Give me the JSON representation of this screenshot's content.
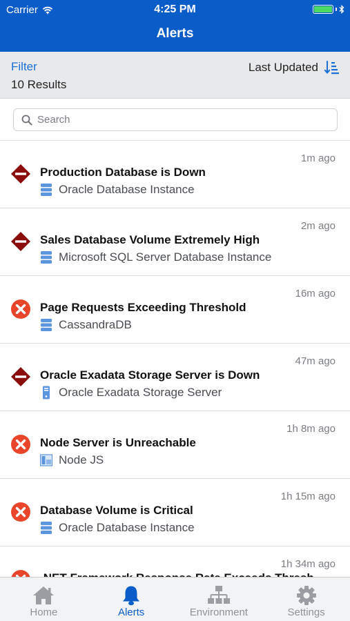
{
  "status_bar": {
    "carrier": "Carrier",
    "time": "4:25 PM"
  },
  "nav": {
    "title": "Alerts"
  },
  "filter_bar": {
    "filter_label": "Filter",
    "results_count": "10 Results",
    "sort_label": "Last Updated"
  },
  "search": {
    "placeholder": "Search"
  },
  "alerts": [
    {
      "title": "Production Database is Down",
      "target": "Oracle Database Instance",
      "time": "1m ago",
      "severity": "fatal",
      "target_icon": "database-icon"
    },
    {
      "title": "Sales Database Volume Extremely High",
      "target": "Microsoft SQL Server Database Instance",
      "time": "2m ago",
      "severity": "fatal",
      "target_icon": "database-icon"
    },
    {
      "title": "Page Requests Exceeding Threshold",
      "target": "CassandraDB",
      "time": "16m ago",
      "severity": "critical",
      "target_icon": "database-icon"
    },
    {
      "title": "Oracle Exadata Storage Server is Down",
      "target": "Oracle Exadata Storage Server",
      "time": "47m ago",
      "severity": "fatal",
      "target_icon": "storage-server-icon"
    },
    {
      "title": "Node Server is Unreachable",
      "target": "Node JS",
      "time": "1h 8m ago",
      "severity": "critical",
      "target_icon": "server-app-icon"
    },
    {
      "title": "Database Volume is Critical",
      "target": "Oracle Database Instance",
      "time": "1h 15m ago",
      "severity": "critical",
      "target_icon": "database-icon"
    },
    {
      "title": ".NET Framework Response Rate Exceeds Thresh",
      "target": "",
      "time": "1h 34m ago",
      "severity": "critical",
      "target_icon": ""
    }
  ],
  "tabs": [
    {
      "label": "Home",
      "icon": "home-icon",
      "active": false
    },
    {
      "label": "Alerts",
      "icon": "bell-icon",
      "active": true
    },
    {
      "label": "Environment",
      "icon": "hierarchy-icon",
      "active": false
    },
    {
      "label": "Settings",
      "icon": "gear-icon",
      "active": false
    }
  ],
  "colors": {
    "brand_blue": "#0a5cc8",
    "fatal_red": "#8b0d0d",
    "critical_orange": "#e8452a",
    "battery_green": "#4cd964"
  }
}
